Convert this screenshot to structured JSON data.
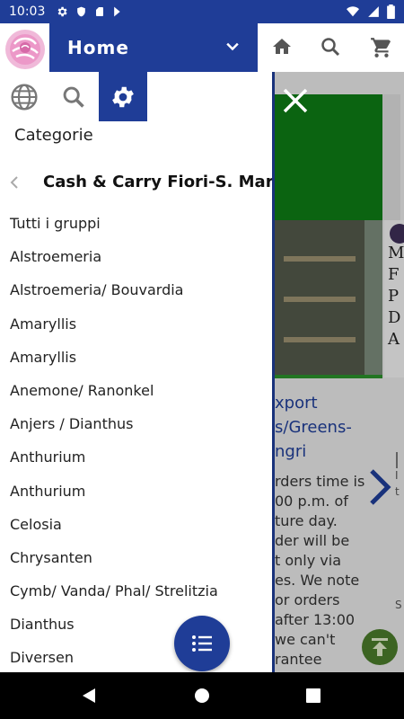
{
  "status": {
    "time": "10:03",
    "left_icons": [
      "gear-icon",
      "shield-icon",
      "sd-card-icon",
      "play-store-icon"
    ],
    "right_icons": [
      "wifi-icon",
      "signal-icon",
      "battery-icon"
    ]
  },
  "header": {
    "title": "Home",
    "icons": [
      "home-icon",
      "search-icon",
      "cart-icon"
    ]
  },
  "drawer": {
    "tabs": [
      "globe-icon",
      "search-icon",
      "gear-icon"
    ],
    "section_title": "Categorie",
    "store_name": "Cash & Carry Fiori-S. Maria",
    "categories": [
      "Tutti i gruppi",
      "Alstroemeria",
      "Alstroemeria/ Bouvardia",
      "Amaryllis",
      "Amaryllis",
      "Anemone/ Ranonkel",
      "Anjers / Dianthus",
      "Anthurium",
      "Anthurium",
      "Celosia",
      "Chrysanten",
      "Cymb/ Vanda/ Phal/ Strelitzia",
      "Dianthus",
      "Diversen"
    ]
  },
  "background": {
    "link_lines": [
      "xport",
      "s/Greens-",
      "ngri"
    ],
    "desc_lines": [
      "rders time is",
      "00 p.m. of",
      "ture day.",
      "der will be",
      "t only via",
      "es. We note",
      "or orders",
      "after 13:00",
      "we can't",
      "rantee"
    ],
    "card_letters": [
      "M",
      "F",
      "P",
      "D",
      "A"
    ],
    "side_text": [
      "I",
      "t",
      "",
      "",
      "",
      "",
      "",
      "",
      "S"
    ]
  },
  "colors": {
    "brand_blue": "#1f3d97",
    "photo_green": "#0e7b15"
  }
}
